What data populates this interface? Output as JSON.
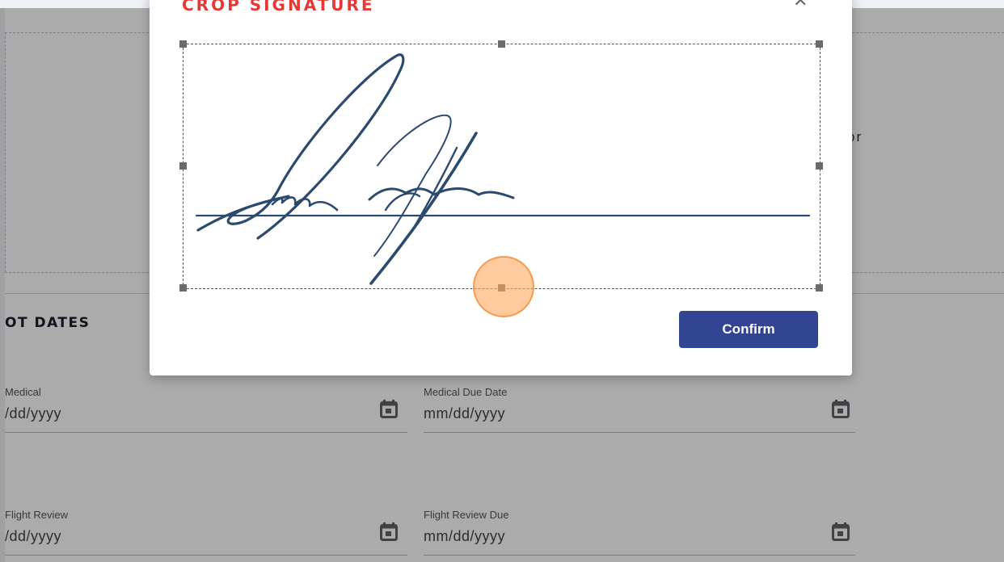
{
  "background_form": {
    "partial_text": "or",
    "section_title": "OT DATES",
    "fields": [
      {
        "label": "Medical",
        "value": "/dd/yyyy",
        "icon": "calendar-icon"
      },
      {
        "label": "Medical Due Date",
        "value": "mm/dd/yyyy",
        "icon": "calendar-icon"
      },
      {
        "label": "Flight Review",
        "value": "/dd/yyyy",
        "icon": "calendar-icon"
      },
      {
        "label": "Flight Review Due",
        "value": "mm/dd/yyyy",
        "icon": "calendar-icon"
      }
    ]
  },
  "modal": {
    "title": "CROP SIGNATURE",
    "close_icon": "close-icon",
    "confirm_label": "Confirm",
    "signature_color": "#2c4a6e"
  },
  "colors": {
    "accent": "#314593",
    "title_red": "#e53935",
    "click_marker": "#ffa65c"
  }
}
